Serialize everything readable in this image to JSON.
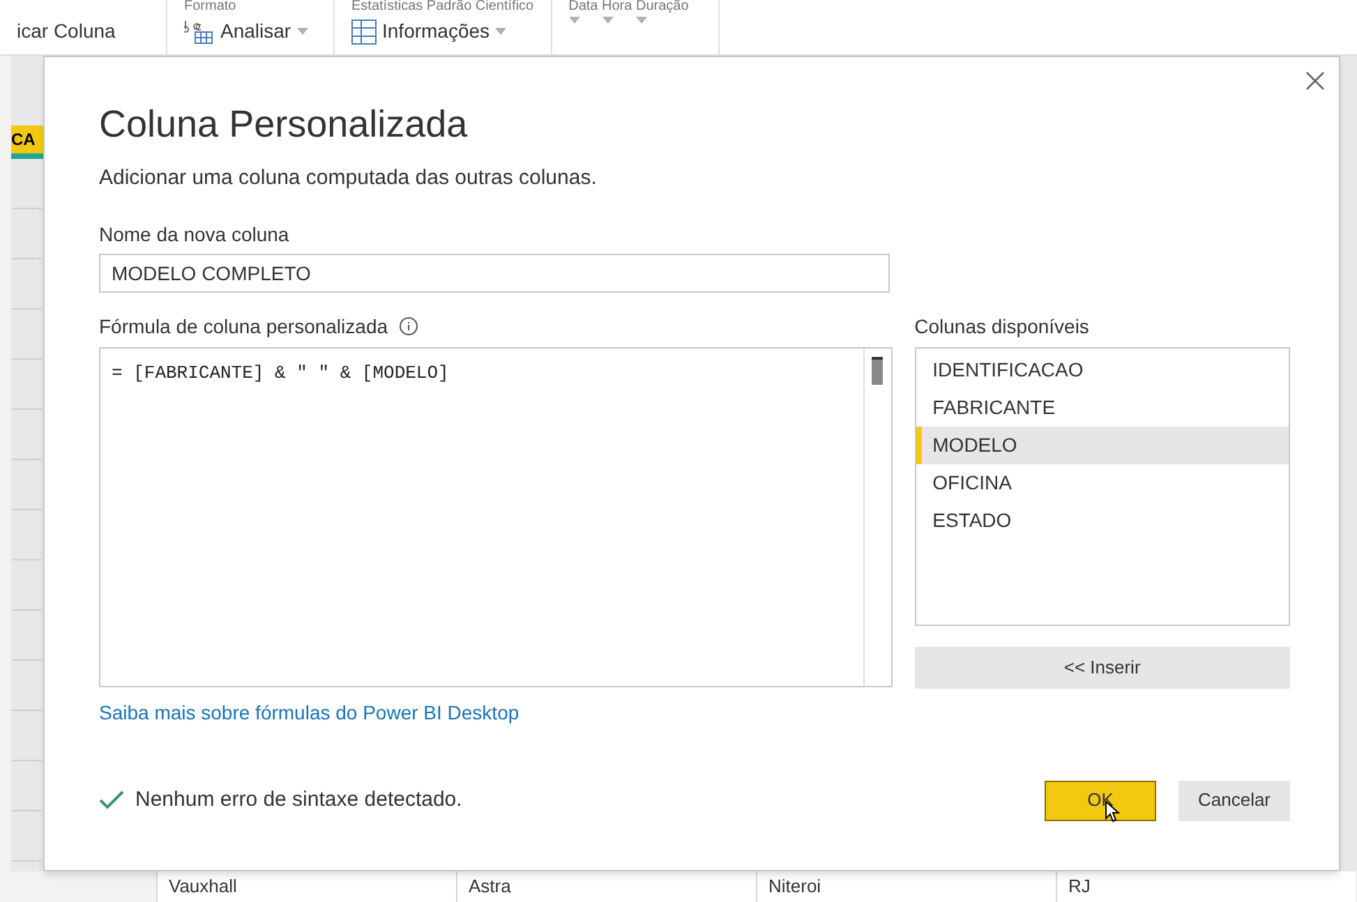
{
  "ribbon": {
    "groups": [
      {
        "items": [
          {
            "label": "icar Coluna",
            "kind": "plain"
          }
        ]
      },
      {
        "title": "Formato",
        "items": [
          {
            "label": "Analisar",
            "kind": "text"
          }
        ]
      },
      {
        "title": "Estatísticas Padrão Científico",
        "items": [
          {
            "label": "Informações",
            "kind": "table"
          }
        ]
      },
      {
        "title": "Data Hora Duração"
      }
    ]
  },
  "table": {
    "header": "CA",
    "rows": [
      {
        "cells": [
          "Vauxhall",
          "Astra",
          "Niteroi",
          "RJ"
        ]
      }
    ]
  },
  "dialog": {
    "title": "Coluna Personalizada",
    "description": "Adicionar uma coluna computada das outras colunas.",
    "name_field": {
      "label": "Nome da nova coluna",
      "value": "MODELO COMPLETO"
    },
    "formula": {
      "label": "Fórmula de coluna personalizada",
      "value": "= [FABRICANTE] & \" \" & [MODELO]"
    },
    "columns": {
      "label": "Colunas disponíveis",
      "items": [
        {
          "label": "IDENTIFICACAO",
          "selected": false
        },
        {
          "label": "FABRICANTE",
          "selected": false
        },
        {
          "label": "MODELO",
          "selected": true
        },
        {
          "label": "OFICINA",
          "selected": false
        },
        {
          "label": "ESTADO",
          "selected": false
        }
      ]
    },
    "insert_button": "<< Inserir",
    "help_link": "Saiba mais sobre fórmulas do Power BI Desktop",
    "status": {
      "ok": true,
      "text": "Nenhum erro de sintaxe detectado."
    },
    "buttons": [
      {
        "label": "OK",
        "kind": "primary"
      },
      {
        "label": "Cancelar",
        "kind": "secondary"
      }
    ]
  }
}
